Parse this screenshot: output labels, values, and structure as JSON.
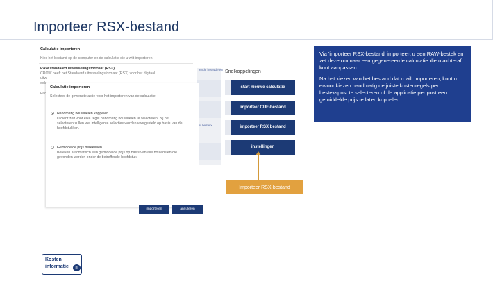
{
  "slide": {
    "title": "Importeer RSX-bestand"
  },
  "dialog_back": {
    "header": "Calculatie importeren",
    "line1": "Kies het bestand op de computer en de calculatie die u wilt importeren.",
    "format_label": "RAW standaard uitwisselingsformaat (RSX)",
    "format_line1": "CROW heeft het Standaard uitwisselingsformaat (RSX) voor het digitaal",
    "format_line2": "uitw",
    "format_line3": "ook",
    "format_line4": "Fac"
  },
  "dialog_front": {
    "header": "Calculatie importeren",
    "instruction": "Selecteer de gewenste actie voor het importeren van de calculatie.",
    "option1_title": "Handmatig bouwdelen koppelen",
    "option1_line1": "U dient zelf voor elke regel handmatig bouwdelen te selecteren. Bij het",
    "option1_line2": "selecteren zullen wel intelligente selecties worden voorgesteld op basis van de",
    "option1_line3": "hoofdstukken.",
    "option2_title": "Gemiddelde prijs berekenen",
    "option2_line1": "Bereken automatisch een gemiddelde prijs op basis van alle bouwdelen die",
    "option2_line2": "gevonden worden onder de betreffende hoofdstuk.",
    "import_button": "importeren",
    "cancel_button": "annuleren"
  },
  "middle_column": {
    "link1": "lende bouwdelen",
    "link2": "at bestelx"
  },
  "shortcuts": {
    "heading": "Snelkoppelingen",
    "items": [
      "start nieuwe calculatie",
      "importeer CUF-bestand",
      "importeer RSX bestand",
      "instellingen"
    ]
  },
  "callout": {
    "para1": "Via 'importeer RSX-bestand' importeert u een RAW-bestek en zet deze om naar een gegenereerde calculatie die u achteraf kunt aanpassen.",
    "para2": "Na het kiezen van het bestand dat u wilt importeren, kunt u ervoor kiezen handmatig de juiste kostenregels per bestekspost te selecteren of de applicatie per post een gemiddelde prijs te laten koppelen."
  },
  "highlight_label": "Importeer RSX-bestand",
  "logo": {
    "line1": "Kosten",
    "line2": "informatie",
    "badge": "nl"
  },
  "colors": {
    "navy": "#1c3a75",
    "callout_blue": "#1f3f8f",
    "orange": "#e2a13f",
    "title_blue": "#1f3864"
  }
}
